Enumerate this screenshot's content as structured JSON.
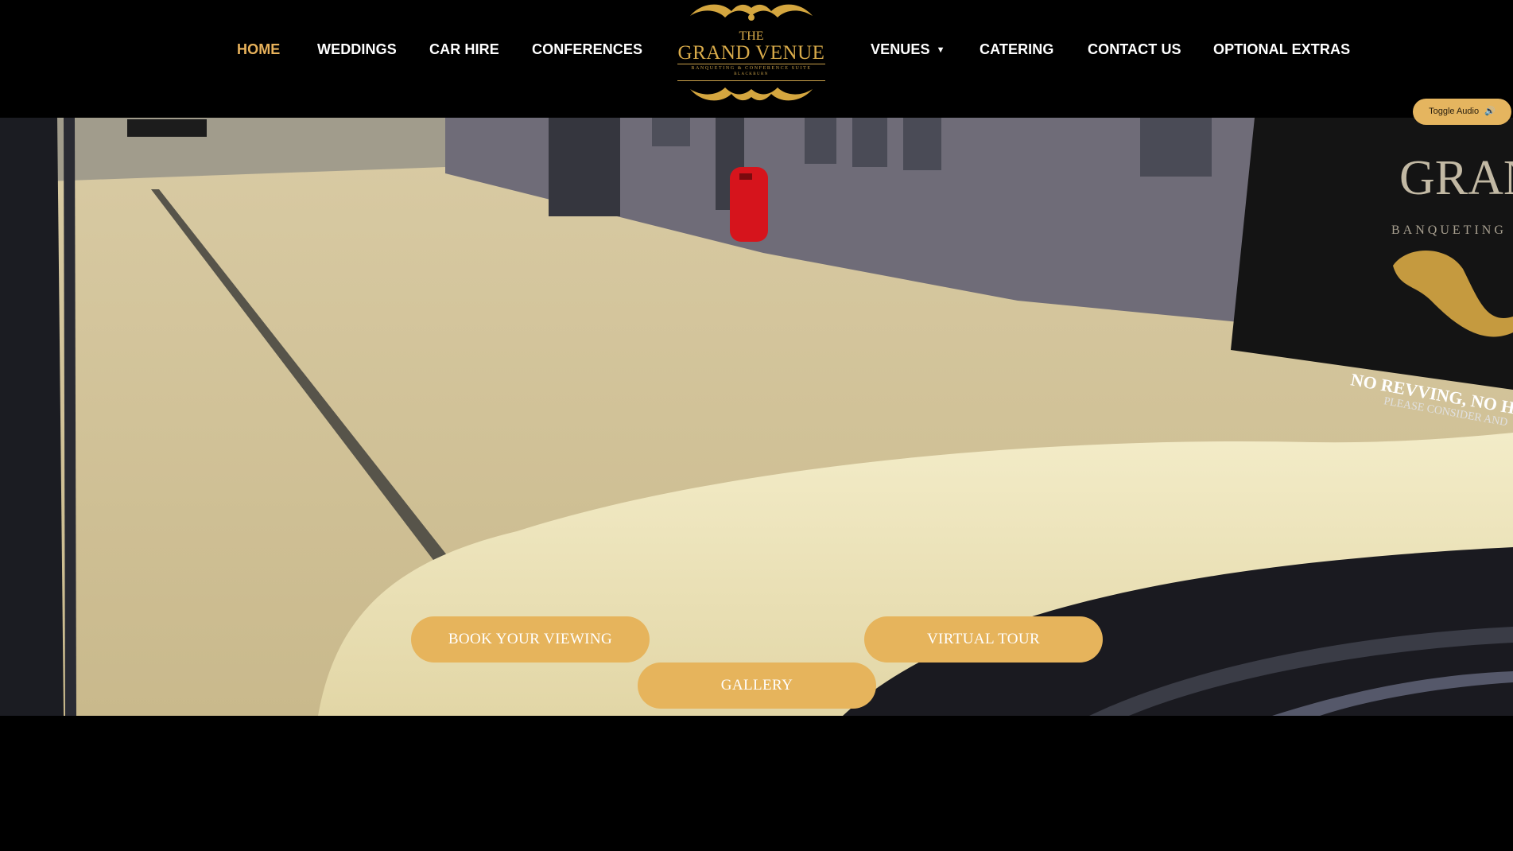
{
  "nav": {
    "left": [
      {
        "label": "HOME",
        "active": true
      },
      {
        "label": "WEDDINGS"
      },
      {
        "label": "CAR HIRE"
      },
      {
        "label": "CONFERENCES"
      }
    ],
    "right": [
      {
        "label": "VENUES",
        "has_dropdown": true
      },
      {
        "label": "CATERING"
      },
      {
        "label": "CONTACT US"
      },
      {
        "label": "OPTIONAL EXTRAS"
      }
    ],
    "dropdown_icon": "chevron-down-icon"
  },
  "logo": {
    "line1": "THE",
    "line2": "GRAND VENUE",
    "line3": "BANQUETING & CONFERENCE SUITE",
    "line4": "BLACKBURN"
  },
  "audio_toggle": {
    "label": "Toggle Audio",
    "icon": "speaker-icon"
  },
  "hero": {
    "sign_lines": [
      "GRAN",
      "BANQUETING",
      "NO REVVING, NO HO",
      "PLEASE CONSIDER AND"
    ],
    "buttons": {
      "book": "BOOK YOUR VIEWING",
      "virtual": "VIRTUAL TOUR",
      "gallery": "GALLERY"
    }
  },
  "colors": {
    "accent": "#e6b45c",
    "nav_active": "#e8b25b",
    "background": "#000000"
  }
}
